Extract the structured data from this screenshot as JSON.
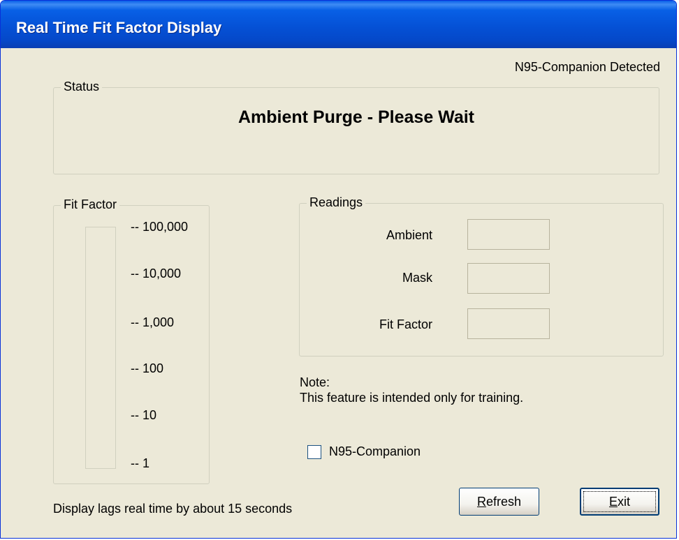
{
  "window": {
    "title": "Real Time Fit Factor Display"
  },
  "detection": "N95-Companion Detected",
  "status": {
    "legend": "Status",
    "message": "Ambient Purge - Please Wait"
  },
  "fit_factor": {
    "legend": "Fit Factor",
    "ticks": [
      "-- 100,000",
      "-- 10,000",
      "-- 1,000",
      "-- 100",
      "-- 10",
      "-- 1"
    ]
  },
  "readings": {
    "legend": "Readings",
    "ambient_label": "Ambient",
    "mask_label": "Mask",
    "fit_factor_label": "Fit Factor",
    "ambient_value": "",
    "mask_value": "",
    "fit_factor_value": ""
  },
  "note": {
    "line1": "Note:",
    "line2": "This feature is intended only for training."
  },
  "checkbox": {
    "label": "N95-Companion",
    "checked": false
  },
  "footer": {
    "lag_text": "Display lags real time by about 15 seconds"
  },
  "buttons": {
    "refresh_underlined": "R",
    "refresh_rest": "efresh",
    "exit_underlined": "E",
    "exit_rest": "xit"
  }
}
